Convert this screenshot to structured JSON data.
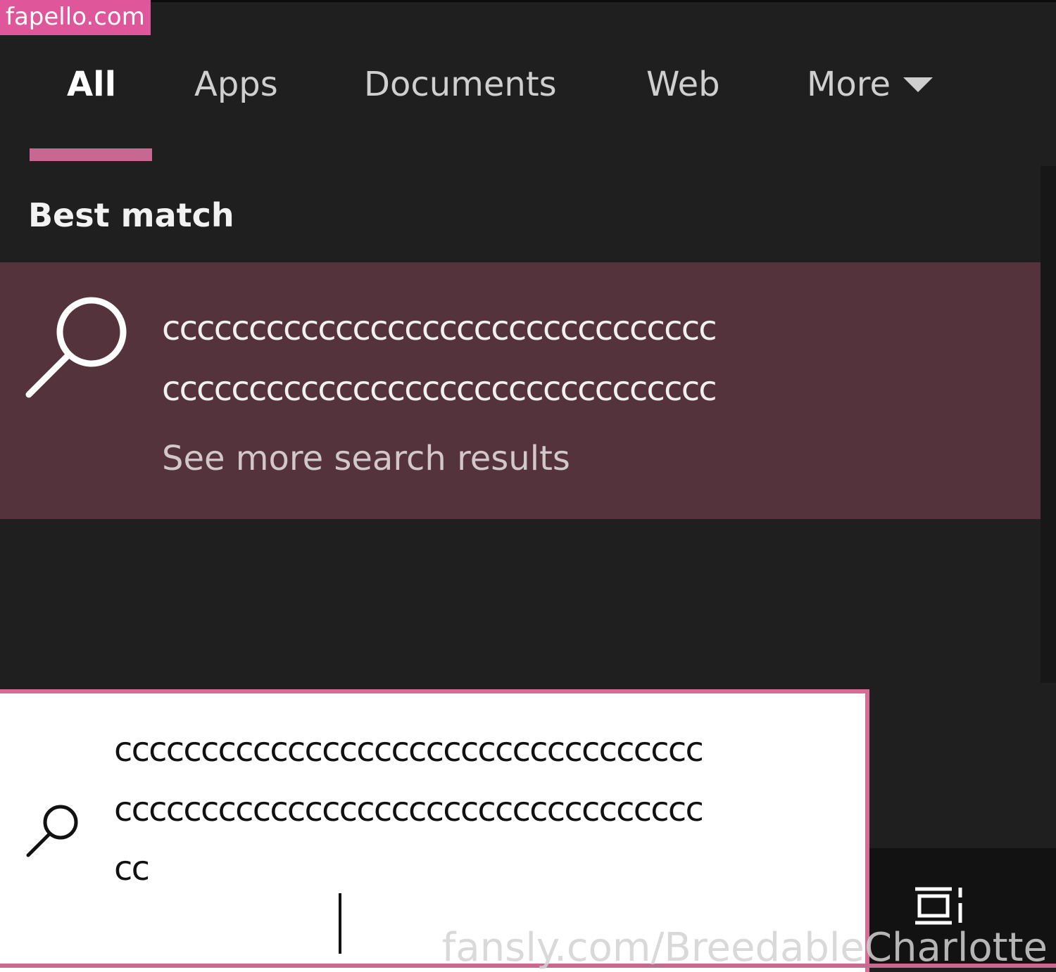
{
  "watermarks": {
    "top": "fapello.com",
    "bottom": "fansly.com/BreedableCharlotte"
  },
  "tabs": [
    {
      "label": "All",
      "active": true
    },
    {
      "label": "Apps",
      "active": false
    },
    {
      "label": "Documents",
      "active": false
    },
    {
      "label": "Web",
      "active": false
    },
    {
      "label": "More",
      "active": false,
      "icon": "caret-down-icon"
    }
  ],
  "section_heading": "Best match",
  "best_match": {
    "icon": "search-icon",
    "lines": [
      "cccccccccccccccccccccccccccccccc",
      "cccccccccccccccccccccccccccccccc"
    ],
    "see_more": "See more search results"
  },
  "search_box": {
    "icon": "search-icon",
    "query_lines": [
      "cccccccccccccccccccccccccccccccccc",
      "cccccccccccccccccccccccccccccccccc",
      "cc"
    ]
  },
  "taskbar": {
    "icon": "task-view-icon"
  },
  "colors": {
    "background": "#1f1f1f",
    "accent": "#c8678f",
    "best_match_bg": "#55333d",
    "search_box_border": "#d86b95"
  }
}
